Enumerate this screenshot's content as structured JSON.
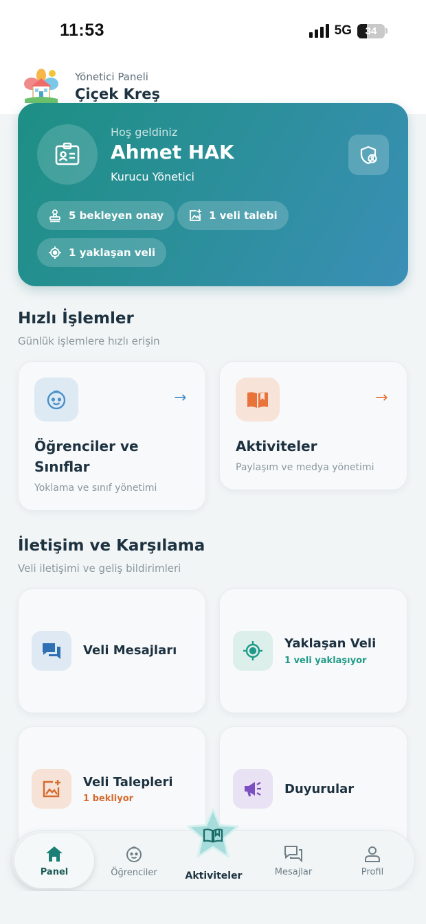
{
  "status_bar": {
    "time": "11:53",
    "network": "5G",
    "battery": "34"
  },
  "header": {
    "subtitle": "Yönetici Paneli",
    "title": "Çiçek Kreş"
  },
  "hero": {
    "greeting": "Hoş geldiniz",
    "name": "Ahmet HAK",
    "role": "Kurucu Yönetici",
    "chips": [
      {
        "label": "5 bekleyen onay",
        "icon": "stamp-icon"
      },
      {
        "label": "1 veli talebi",
        "icon": "add-photo-icon"
      },
      {
        "label": "1 yaklaşan veli",
        "icon": "location-target-icon"
      }
    ]
  },
  "quick": {
    "title": "Hızlı İşlemler",
    "subtitle": "Günlük işlemlere hızlı erişin",
    "cards": [
      {
        "title_line1": "Öğrenciler ve",
        "title_line2": "Sınıflar",
        "subtitle": "Yoklama ve sınıf yönetimi",
        "icon": "child-face-icon",
        "accent": "#4a90c8"
      },
      {
        "title_line1": "Aktiviteler",
        "subtitle": "Paylaşım ve medya yönetimi",
        "icon": "open-book-icon",
        "accent": "#e8743b"
      }
    ]
  },
  "comm": {
    "title": "İletişim ve Karşılama",
    "subtitle": "Veli iletişimi ve geliş bildirimleri",
    "cards": [
      {
        "title": "Veli Mesajları",
        "note": "",
        "icon": "chat-icon",
        "accent": "#2f6fb3"
      },
      {
        "title": "Yaklaşan Veli",
        "note": "1 veli yaklaşıyor",
        "icon": "location-target-icon",
        "accent": "#1f9a88"
      },
      {
        "title": "Veli Talepleri",
        "note": "1 bekliyor",
        "icon": "add-photo-icon",
        "accent": "#d46a2e"
      },
      {
        "title": "Duyurular",
        "note": "",
        "icon": "megaphone-icon",
        "accent": "#7b4fc0"
      }
    ]
  },
  "nav": {
    "items": [
      {
        "label": "Panel",
        "icon": "home-icon",
        "active": true
      },
      {
        "label": "Öğrenciler",
        "icon": "child-face-icon"
      },
      {
        "label": "Aktiviteler",
        "icon": "open-book-icon"
      },
      {
        "label": "Mesajlar",
        "icon": "chat-icon"
      },
      {
        "label": "Profil",
        "icon": "person-icon"
      }
    ]
  }
}
